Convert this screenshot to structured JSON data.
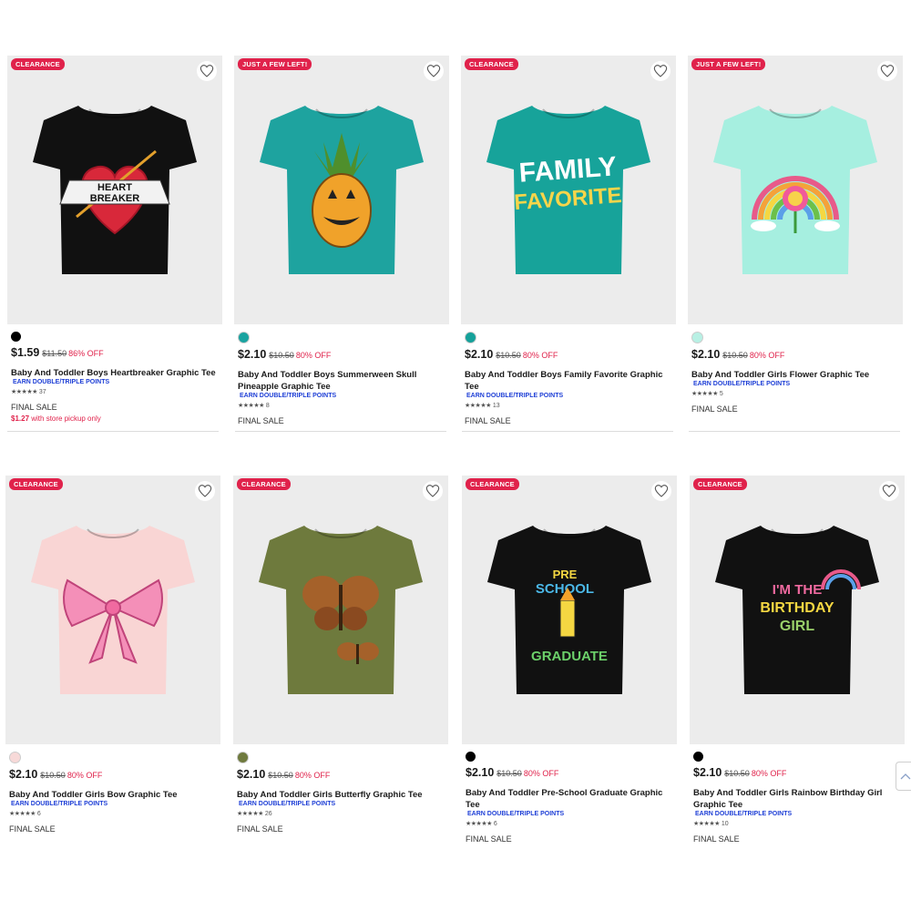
{
  "products": [
    {
      "badge": "CLEARANCE",
      "swatch": "#000000",
      "price": "$1.59",
      "orig": "$11.50",
      "off": "86% OFF",
      "title": "Baby And Toddler Boys Heartbreaker Graphic Tee",
      "points": "EARN DOUBLE/TRIPLE POINTS",
      "stars": "★★★★★",
      "reviews": "37",
      "final": "FINAL SALE",
      "pickup_price": "$1.27",
      "pickup_text": " with store pickup only",
      "shirt_color": "#111111",
      "graphic": "heart"
    },
    {
      "badge": "JUST A FEW LEFT!",
      "swatch": "#1aa3a0",
      "price": "$2.10",
      "orig": "$10.50",
      "off": "80% OFF",
      "title": "Baby And Toddler Boys Summerween Skull Pineapple Graphic Tee",
      "points": "EARN DOUBLE/TRIPLE POINTS",
      "stars": "★★★★★",
      "reviews": "8",
      "final": "FINAL SALE",
      "shirt_color": "#1ea39f",
      "graphic": "pineapple"
    },
    {
      "badge": "CLEARANCE",
      "swatch": "#15a19a",
      "price": "$2.10",
      "orig": "$10.50",
      "off": "80% OFF",
      "title": "Baby And Toddler Boys Family Favorite Graphic Tee",
      "points": "EARN DOUBLE/TRIPLE POINTS",
      "stars": "★★★★★",
      "reviews": "13",
      "final": "FINAL SALE",
      "shirt_color": "#17a39a",
      "graphic": "family",
      "graphic_text1": "FAMILY",
      "graphic_text2": "FAVORITE"
    },
    {
      "badge": "JUST A FEW LEFT!",
      "swatch": "#b8f0e4",
      "price": "$2.10",
      "orig": "$10.50",
      "off": "80% OFF",
      "title": "Baby And Toddler Girls Flower Graphic Tee",
      "points": "EARN DOUBLE/TRIPLE POINTS",
      "stars": "★★★★★",
      "reviews": "5",
      "final": "FINAL SALE",
      "shirt_color": "#a6efe0",
      "graphic": "rainbow"
    },
    {
      "badge": "CLEARANCE",
      "swatch": "#f7d9d8",
      "price": "$2.10",
      "orig": "$10.50",
      "off": "80% OFF",
      "title": "Baby And Toddler Girls Bow Graphic Tee",
      "points": "EARN DOUBLE/TRIPLE POINTS",
      "stars": "★★★★★",
      "reviews": "6",
      "final": "FINAL SALE",
      "shirt_color": "#f9d5d4",
      "graphic": "bow"
    },
    {
      "badge": "CLEARANCE",
      "swatch": "#6f7a3e",
      "price": "$2.10",
      "orig": "$10.50",
      "off": "80% OFF",
      "title": "Baby And Toddler Girls Butterfly Graphic Tee",
      "points": "EARN DOUBLE/TRIPLE POINTS",
      "stars": "★★★★★",
      "reviews": "26",
      "final": "FINAL SALE",
      "shirt_color": "#6e7a3d",
      "graphic": "butterfly"
    },
    {
      "badge": "CLEARANCE",
      "swatch": "#000000",
      "price": "$2.10",
      "orig": "$10.50",
      "off": "80% OFF",
      "title": "Baby And Toddler Pre-School Graduate Graphic Tee",
      "points": "EARN DOUBLE/TRIPLE POINTS",
      "stars": "★★★★★",
      "reviews": "6",
      "final": "FINAL SALE",
      "shirt_color": "#111111",
      "graphic": "preschool",
      "graphic_text1": "PRE",
      "graphic_text2": "SCHOOL",
      "graphic_text3": "GRADUATE"
    },
    {
      "badge": "CLEARANCE",
      "swatch": "#000000",
      "price": "$2.10",
      "orig": "$10.50",
      "off": "80% OFF",
      "title": "Baby And Toddler Girls Rainbow Birthday Girl Graphic Tee",
      "points": "EARN DOUBLE/TRIPLE POINTS",
      "stars": "★★★★★",
      "reviews": "10",
      "final": "FINAL SALE",
      "shirt_color": "#111111",
      "graphic": "birthday",
      "graphic_text1": "I'M THE",
      "graphic_text2": "BIRTHDAY",
      "graphic_text3": "GIRL"
    }
  ],
  "heartbreaker_text1": "HEART",
  "heartbreaker_text2": "BREAKER",
  "colors": {
    "badge": "#e0224b",
    "points": "#1e3fd6",
    "image_bg": "#ececec"
  }
}
